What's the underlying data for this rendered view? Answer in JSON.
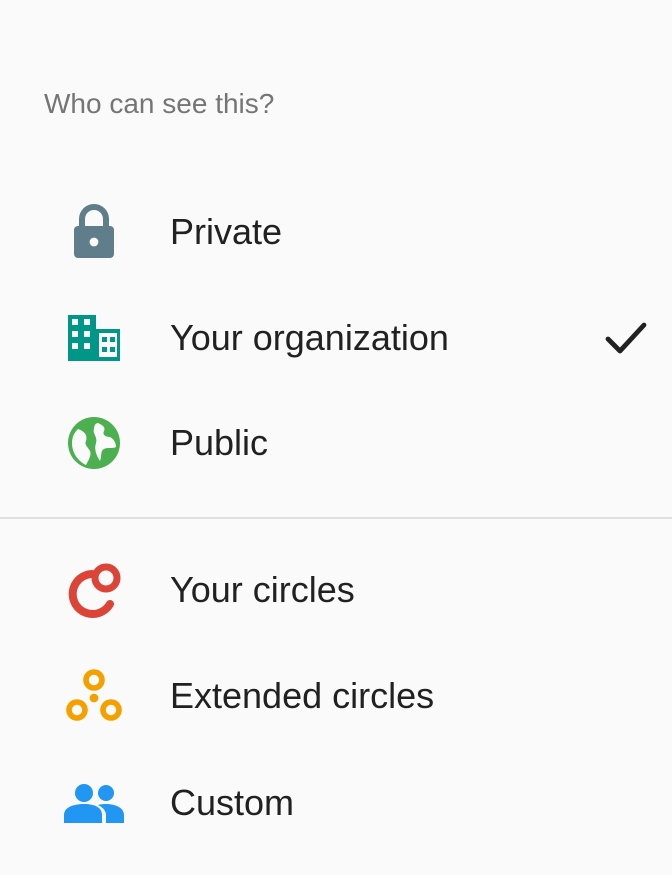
{
  "menu": {
    "header": "Who can see this?",
    "items": [
      {
        "label": "Private",
        "icon": "lock-icon",
        "color": "#607d8b",
        "selected": false
      },
      {
        "label": "Your organization",
        "icon": "domain-icon",
        "color": "#009688",
        "selected": true
      },
      {
        "label": "Public",
        "icon": "globe-icon",
        "color": "#4caf50",
        "selected": false
      },
      {
        "label": "Your circles",
        "icon": "circles-icon",
        "color": "#db4437",
        "selected": false
      },
      {
        "label": "Extended circles",
        "icon": "extended-circles-icon",
        "color": "#f4a100",
        "selected": false
      },
      {
        "label": "Custom",
        "icon": "people-icon",
        "color": "#2196f3",
        "selected": false
      }
    ],
    "check_icon": "checkmark-icon"
  }
}
